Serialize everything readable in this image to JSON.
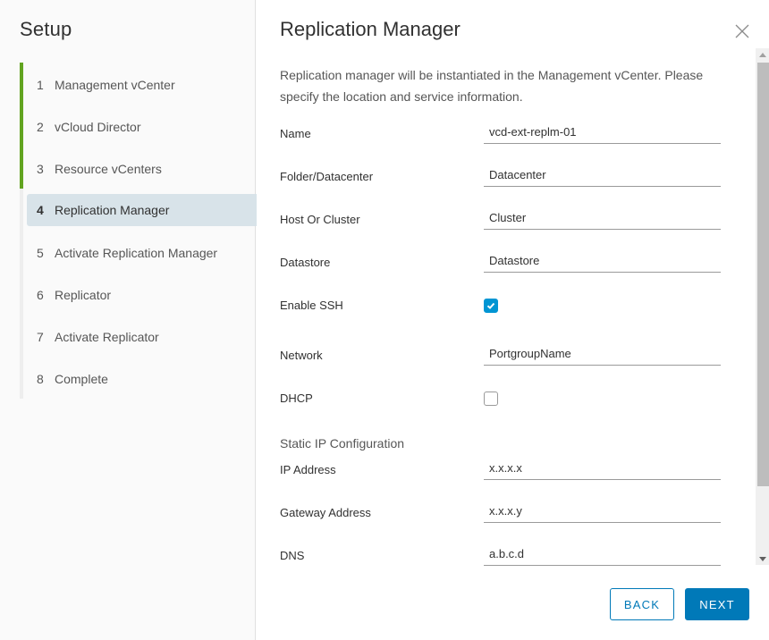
{
  "sidebar": {
    "title": "Setup",
    "steps": [
      {
        "num": "1",
        "label": "Management vCenter",
        "state": "completed"
      },
      {
        "num": "2",
        "label": "vCloud Director",
        "state": "completed"
      },
      {
        "num": "3",
        "label": "Resource vCenters",
        "state": "completed"
      },
      {
        "num": "4",
        "label": "Replication Manager",
        "state": "active"
      },
      {
        "num": "5",
        "label": "Activate Replication Manager",
        "state": "pending"
      },
      {
        "num": "6",
        "label": "Replicator",
        "state": "pending"
      },
      {
        "num": "7",
        "label": "Activate Replicator",
        "state": "pending"
      },
      {
        "num": "8",
        "label": "Complete",
        "state": "pending"
      }
    ],
    "progress_color": "#62a420"
  },
  "main": {
    "title": "Replication Manager",
    "close_icon": "close-icon",
    "intro": "Replication manager will be instantiated in the Management vCenter. Please specify the location and service information.",
    "fields": {
      "name": {
        "label": "Name",
        "value": "vcd-ext-replm-01"
      },
      "folder": {
        "label": "Folder/Datacenter",
        "value": "Datacenter"
      },
      "host": {
        "label": "Host Or Cluster",
        "value": "Cluster"
      },
      "datastore": {
        "label": "Datastore",
        "value": "Datastore"
      },
      "ssh": {
        "label": "Enable SSH",
        "checked": true
      },
      "network": {
        "label": "Network",
        "value": "PortgroupName"
      },
      "dhcp": {
        "label": "DHCP",
        "checked": false
      },
      "static_section": "Static IP Configuration",
      "ip": {
        "label": "IP Address",
        "value": "x.x.x.x"
      },
      "gateway": {
        "label": "Gateway Address",
        "value": "x.x.x.y"
      },
      "dns": {
        "label": "DNS",
        "value": "a.b.c.d"
      }
    }
  },
  "buttons": {
    "back": "BACK",
    "next": "NEXT"
  },
  "colors": {
    "accent": "#0079b8",
    "checkbox": "#0095d3",
    "active_step_bg": "#d8e3e9"
  }
}
